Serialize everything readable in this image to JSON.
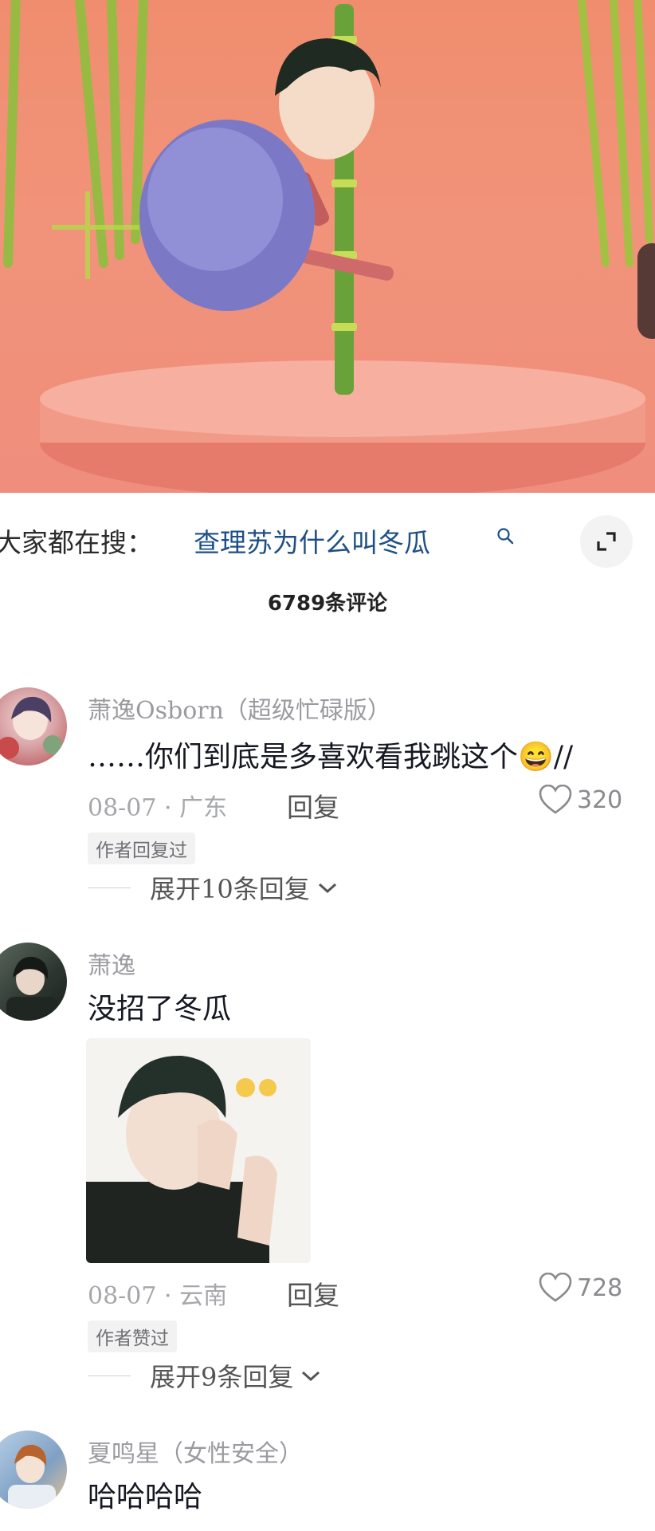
{
  "search": {
    "prefix": "大家都在搜：",
    "query": "查理苏为什么叫冬瓜"
  },
  "comment_count": "6789条评论",
  "colors": {
    "link": "#1d4f86",
    "muted": "#a6a7ab",
    "video_bg": "#f08d6e"
  },
  "comments": [
    {
      "username": "萧逸Osborn（超级忙碌版）",
      "text": "……你们到底是多喜欢看我跳这个😄//",
      "date_location": "08-07 · 广东",
      "reply_label": "回复",
      "likes": "320",
      "tag": "作者回复过",
      "expand_label": "展开10条回复"
    },
    {
      "username": "萧逸",
      "text": "没招了冬瓜",
      "date_location": "08-07 · 云南",
      "reply_label": "回复",
      "likes": "728",
      "tag": "作者赞过",
      "expand_label": "展开9条回复"
    },
    {
      "username": "夏鸣星（女性安全）",
      "text": "哈哈哈哈"
    }
  ]
}
